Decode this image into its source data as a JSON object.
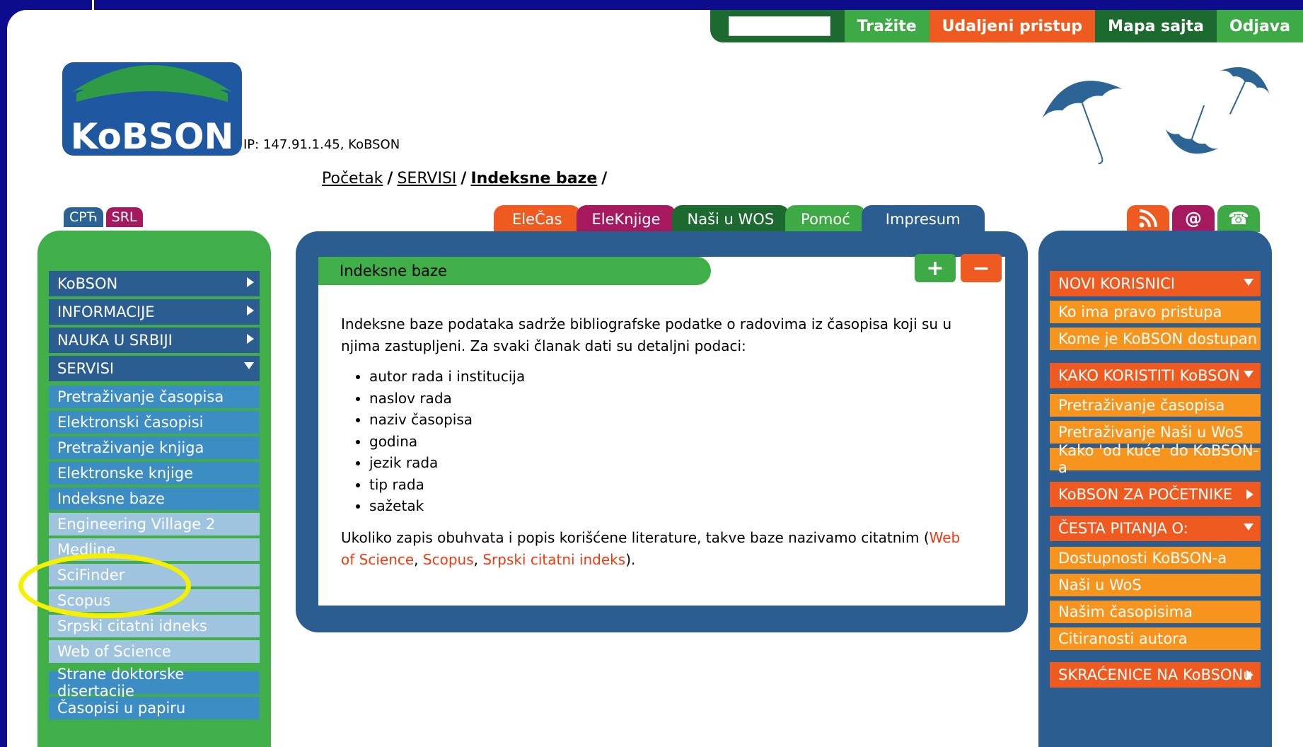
{
  "top_nav": {
    "search_value": "",
    "search_button": "Tražite",
    "remote_access": "Udaljeni pristup",
    "sitemap": "Mapa sajta",
    "logout": "Odjava"
  },
  "logo": {
    "text": "KoBSON"
  },
  "ip_text": "IP: 147.91.1.45, KoBSON",
  "breadcrumb": {
    "home": "Početak",
    "services": "SERVISI",
    "current": "Indeksne baze",
    "sep": "/"
  },
  "languages": {
    "cyrillic": "СРЋ",
    "latin": "SRL"
  },
  "left_menu": {
    "main": [
      {
        "label": "KoBSON"
      },
      {
        "label": "INFORMACIJE"
      },
      {
        "label": "NAUKA U SRBIJI"
      },
      {
        "label": "SERVISI"
      }
    ],
    "sub": [
      {
        "label": "Pretraživanje časopisa"
      },
      {
        "label": "Elektronski časopisi"
      },
      {
        "label": "Pretraživanje knjiga"
      },
      {
        "label": "Elektronske knjige"
      },
      {
        "label": "Indeksne baze"
      },
      {
        "label": "Engineering Village 2"
      },
      {
        "label": "Medline"
      },
      {
        "label": "SciFinder"
      },
      {
        "label": "Scopus"
      },
      {
        "label": "Srpski citatni idneks"
      },
      {
        "label": "Web of Science"
      },
      {
        "label": "Strane doktorske disertacije"
      },
      {
        "label": "Časopisi u papiru"
      }
    ]
  },
  "tabs": [
    {
      "label": "EleČas"
    },
    {
      "label": "EleKnjige"
    },
    {
      "label": "Naši u WOS"
    },
    {
      "label": "Pomoć"
    },
    {
      "label": "Impresum"
    }
  ],
  "content": {
    "title": "Indeksne baze",
    "plus": "+",
    "minus": "−",
    "intro": "Indeksne baze podataka sadrže bibliografske podatke o radovima iz časopisa koji su u njima zastupljeni. Za svaki članak dati su detaljni podaci:",
    "items": [
      "autor rada i institucija",
      "naslov rada",
      "naziv časopisa",
      "godina",
      "jezik rada",
      "tip rada",
      "sažetak"
    ],
    "outro_pre": "Ukoliko zapis obuhvata i popis korišćene literature, takve baze nazivamo citatnim (",
    "link_wos": "Web of Science",
    "comma1": ", ",
    "link_scopus": "Scopus",
    "comma2": ", ",
    "link_sci": "Srpski citatni indeks",
    "outro_post": ")."
  },
  "right_icons": {
    "rss": "rss-icon",
    "email": "@",
    "phone": "☎"
  },
  "right_menu": {
    "novi": "NOVI KORISNICI",
    "novi_items": [
      "Ko ima pravo pristupa",
      "Kome je KoBSON dostupan"
    ],
    "kako": "KAKO KORISTITI KoBSON",
    "kako_items": [
      "Pretraživanje časopisa",
      "Pretraživanje Naši u WoS",
      "Kako 'od kuće' do KoBSON-a"
    ],
    "pocetnike": "KoBSON ZA POČETNIKE",
    "pitanja": "ČESTA PITANJA O:",
    "pitanja_items": [
      "Dostupnosti KoBSON-a",
      "Naši u WoS",
      "Našim časopisima",
      "Citiranosti autora"
    ],
    "skracenice": "SKRAĆENICE NA KoBSONu"
  },
  "colors": {
    "green": "#40ae49",
    "blue": "#2c5d90",
    "orange": "#ee5a20",
    "highlight": "#f5ef00"
  }
}
